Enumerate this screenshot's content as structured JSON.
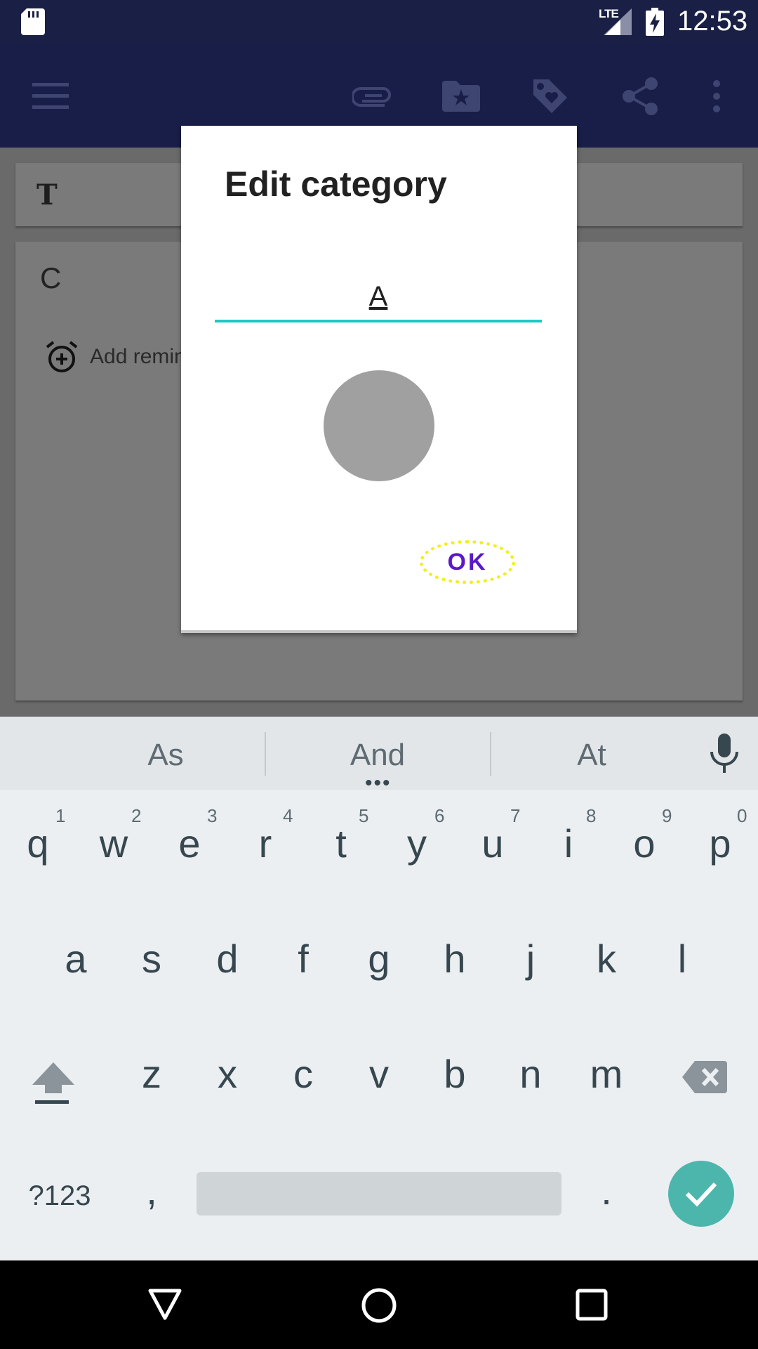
{
  "status_bar": {
    "network": "LTE",
    "time": "12:53"
  },
  "app_bar": {
    "icons": [
      "menu-icon",
      "attachment-icon",
      "category-icon",
      "tag-icon",
      "share-icon",
      "more-icon"
    ]
  },
  "note": {
    "title": "T",
    "content": "C",
    "reminder_label": "Add remin"
  },
  "dialog": {
    "title": "Edit category",
    "name_value": "A",
    "selected_color": "#a0a0a0",
    "ok_label": "OK"
  },
  "keyboard": {
    "suggestions": [
      "As",
      "And",
      "At"
    ],
    "row1": [
      "q",
      "w",
      "e",
      "r",
      "t",
      "y",
      "u",
      "i",
      "o",
      "p"
    ],
    "row1_hints": [
      "1",
      "2",
      "3",
      "4",
      "5",
      "6",
      "7",
      "8",
      "9",
      "0"
    ],
    "row2": [
      "a",
      "s",
      "d",
      "f",
      "g",
      "h",
      "j",
      "k",
      "l"
    ],
    "row3": [
      "z",
      "x",
      "c",
      "v",
      "b",
      "n",
      "m"
    ],
    "symbols_label": "?123",
    "comma": ",",
    "period": ".",
    "accent_color": "#4db6ac"
  },
  "colors": {
    "input_underline": "#1ec9c0",
    "ok_text": "#5b19c7",
    "ok_highlight": "#f2ef1a"
  }
}
